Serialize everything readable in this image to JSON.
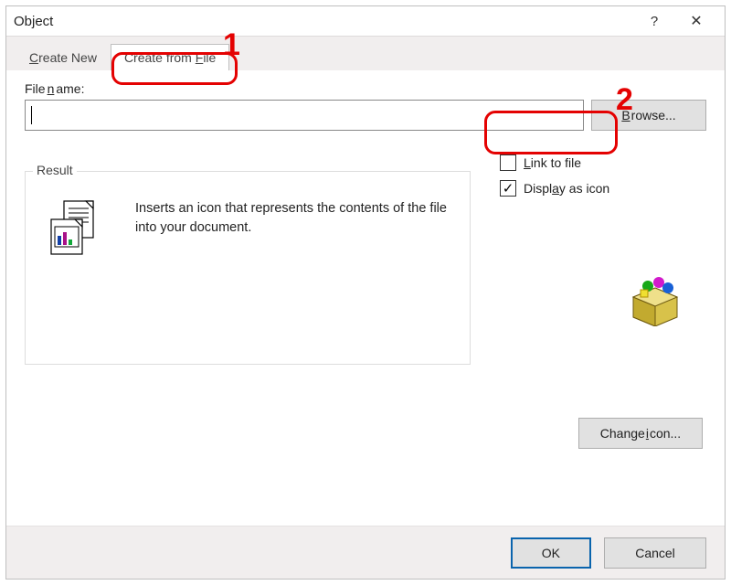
{
  "title": "Object",
  "titlebar": {
    "help": "?",
    "close": "✕"
  },
  "tabs": {
    "create_new_c": "C",
    "create_new_rest": "reate New",
    "create_from_file_label": "Create from ",
    "create_from_file_f": "F",
    "create_from_file_rest": "ile"
  },
  "file": {
    "label_pre": "File ",
    "label_u": "n",
    "label_post": "ame:",
    "value": ""
  },
  "browse": {
    "u": "B",
    "rest": "rowse..."
  },
  "options": {
    "link_u": "L",
    "link_rest": "ink to file",
    "display_pre": "Displ",
    "display_u": "a",
    "display_post": "y as icon"
  },
  "result": {
    "legend": "Result",
    "text": "Inserts an icon that represents the contents of the file into your document."
  },
  "change_icon": {
    "label": "Change ",
    "u": "i",
    "rest": "con..."
  },
  "footer": {
    "ok": "OK",
    "cancel": "Cancel"
  },
  "annotations": {
    "one": "1",
    "two": "2"
  },
  "state": {
    "link_checked": false,
    "display_checked": true
  }
}
